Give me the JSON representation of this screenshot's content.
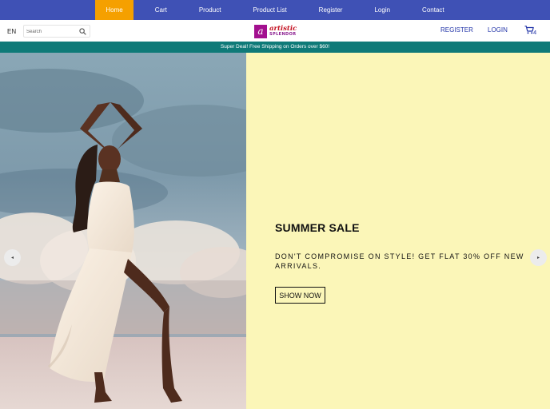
{
  "nav": {
    "items": [
      {
        "label": "Home",
        "active": true
      },
      {
        "label": "Cart"
      },
      {
        "label": "Product"
      },
      {
        "label": "Product List"
      },
      {
        "label": "Register"
      },
      {
        "label": "Login"
      },
      {
        "label": "Contact"
      }
    ],
    "bg_color": "#3f51b5",
    "active_color": "#f5a000"
  },
  "header": {
    "language": "EN",
    "search_placeholder": "Search",
    "logo_mark": "a",
    "logo_line1": "artistic",
    "logo_line2": "SPLENDOR",
    "register_label": "REGISTER",
    "login_label": "LOGIN",
    "cart_count": "4"
  },
  "announcement": {
    "text": "Super Deal! Free Shipping on Orders over $60!",
    "bg_color": "#0f7a78"
  },
  "hero": {
    "title": "SUMMER SALE",
    "description": "DON'T COMPROMISE ON STYLE! GET FLAT 30% OFF NEW ARRIVALS.",
    "button_label": "SHOW NOW",
    "panel_color": "#fbf6b8",
    "prev_icon": "◂",
    "next_icon": "▸"
  },
  "icons": {
    "search": "search-icon",
    "cart": "cart-icon",
    "prev": "chevron-left-icon",
    "next": "chevron-right-icon"
  }
}
